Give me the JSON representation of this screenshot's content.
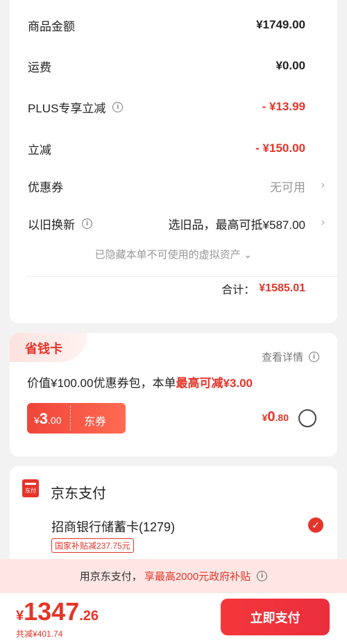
{
  "summary": {
    "rows": [
      {
        "label": "商品金额",
        "value": "¥1749.00"
      },
      {
        "label": "运费",
        "value": "¥0.00"
      },
      {
        "label": "PLUS专享立减",
        "value": "- ¥13.99"
      },
      {
        "label": "立减",
        "value": "- ¥150.00"
      },
      {
        "label": "优惠券",
        "value": "无可用"
      },
      {
        "label": "以旧换新",
        "value": "选旧品，最高可抵¥587.00"
      }
    ],
    "info_icon": "i",
    "chevron": "›",
    "hidden_assets": "已隐藏本单不可使用的虚拟资产",
    "hidden_chevron": "⌄",
    "total_label": "合计：",
    "total_value": "¥1585.01"
  },
  "saver": {
    "title": "省钱卡",
    "detail": "查看详情",
    "desc_prefix": "价值¥100.00优惠券包，本单",
    "desc_highlight": "最高可减¥3.00",
    "coupon_currency": "¥",
    "coupon_int": "3",
    "coupon_dec": ".00",
    "coupon_label": "东券",
    "price_currency": "¥",
    "price_int": "0",
    "price_dec": ".80"
  },
  "payment": {
    "logo_text": "东付",
    "title": "京东支付",
    "bank": "招商银行储蓄卡(1279)",
    "check": "✓",
    "subsidy_tag": "国家补贴减237.75元"
  },
  "promo": {
    "prefix": "用京东支付，",
    "highlight": "享最高2000元政府补贴"
  },
  "footer": {
    "currency": "¥",
    "int": "1347",
    "dec": ".26",
    "saved": "共减¥401.74",
    "pay_button": "立即支付"
  },
  "colors": {
    "accent": "#e5352a",
    "background": "#f2f2f2"
  },
  "icons": [
    "info-icon",
    "chevron-right-icon",
    "chevron-down-icon",
    "jd-pay-logo-icon",
    "check-circle-icon",
    "radio-icon"
  ]
}
